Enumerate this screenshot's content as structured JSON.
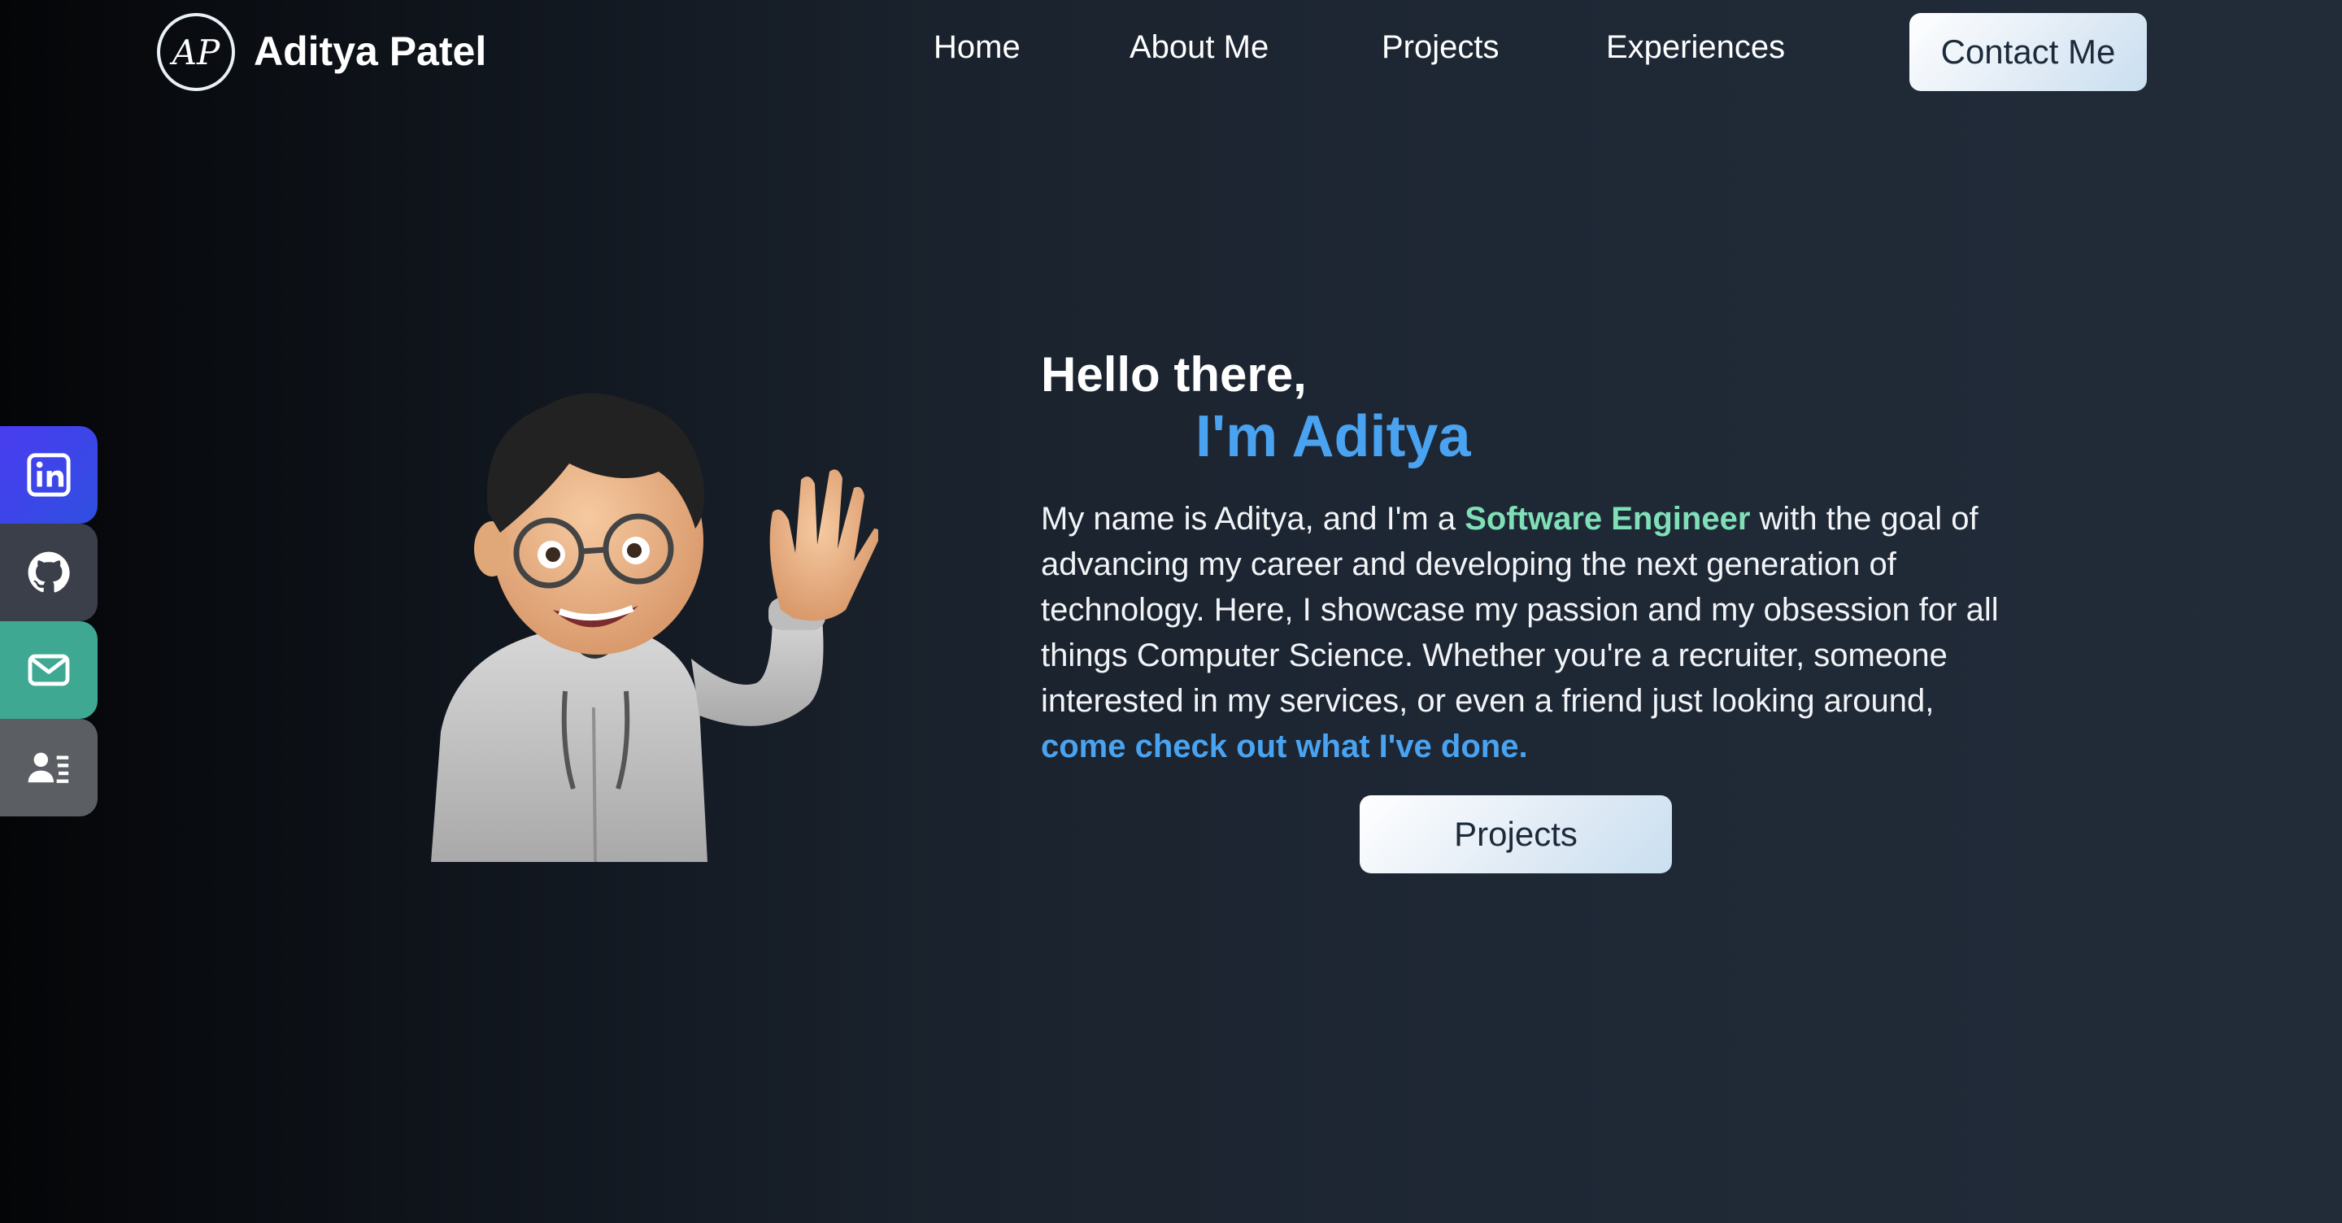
{
  "header": {
    "logo_text": "AP",
    "brand_name": "Aditya Patel",
    "nav": [
      "Home",
      "About Me",
      "Projects",
      "Experiences"
    ],
    "contact_label": "Contact Me"
  },
  "social": [
    {
      "name": "linkedin-icon",
      "color": "#3b3ff0"
    },
    {
      "name": "github-icon",
      "color": "#3a3f4a"
    },
    {
      "name": "mail-icon",
      "color": "#3fa892"
    },
    {
      "name": "contact-card-icon",
      "color": "#5b5e63"
    }
  ],
  "hero": {
    "greeting": "Hello there,",
    "name_line": "I'm Aditya",
    "bio_pre": "My name is Aditya, and I'm a ",
    "bio_role": "Software Engineer",
    "bio_mid": " with the goal of advancing my career and developing the next generation of technology. Here, I showcase my passion and my obsession for all things Computer Science. Whether you're a recruiter, someone interested in my services, or even a friend just looking around, ",
    "bio_link": "come check out what I've done.",
    "cta_label": "Projects"
  },
  "colors": {
    "accent_blue": "#4aa3f0",
    "accent_green": "#7fe0b8"
  }
}
